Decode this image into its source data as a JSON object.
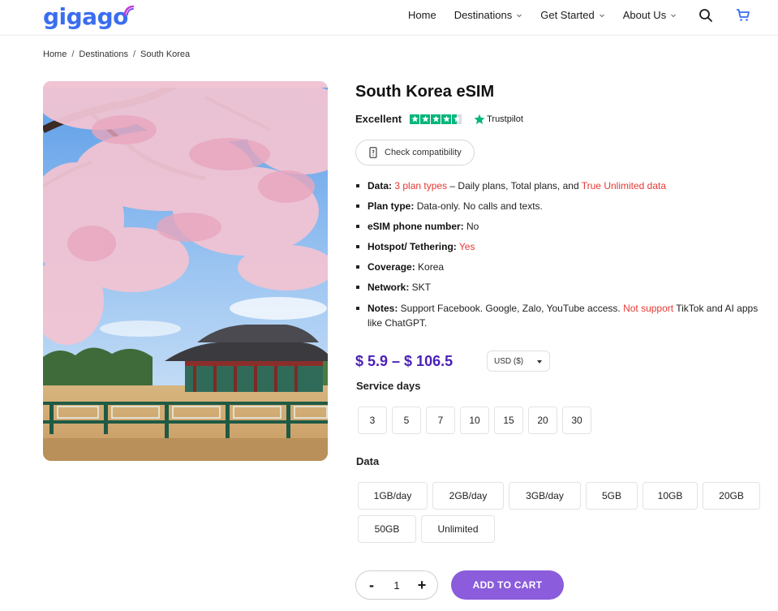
{
  "brand": {
    "logo_text": "gigago",
    "accent": "#3a6df0",
    "purple": "#8b5cdb"
  },
  "nav": {
    "items": [
      {
        "label": "Home",
        "dropdown": false
      },
      {
        "label": "Destinations",
        "dropdown": true
      },
      {
        "label": "Get Started",
        "dropdown": true
      },
      {
        "label": "About Us",
        "dropdown": true
      }
    ],
    "icons": [
      "search-icon",
      "cart-icon"
    ]
  },
  "breadcrumb": [
    "Home",
    "Destinations",
    "South Korea"
  ],
  "product": {
    "title": "South Korea eSIM",
    "rating_text": "Excellent",
    "trustpilot": "Trustpilot",
    "stars": 4.5,
    "compat_label": "Check compatibility",
    "features": {
      "data_label": "Data:",
      "data_plans": "3 plan types",
      "data_middle": " – Daily plans, Total plans, and ",
      "data_unlimited": "True Unlimited data",
      "plan_label": "Plan type:",
      "plan_value": " Data-only. No calls and texts.",
      "phone_label": "eSIM phone number:",
      "phone_value": " No",
      "hotspot_label": "Hotspot/ Tethering:",
      "hotspot_value": " Yes",
      "coverage_label": "Coverage:",
      "coverage_value": " Korea",
      "network_label": "Network:",
      "network_value": " SKT",
      "notes_label": "Notes:",
      "notes_value": " Support Facebook. Google, Zalo, YouTube access. ",
      "notes_not": "Not support",
      "notes_end": " TikTok and AI apps like ChatGPT."
    },
    "price": "$ 5.9 – $ 106.5",
    "currency": "USD ($)",
    "service_days_label": "Service days",
    "service_days": [
      "3",
      "5",
      "7",
      "10",
      "15",
      "20",
      "30"
    ],
    "data_label": "Data",
    "data_options": [
      "1GB/day",
      "2GB/day",
      "3GB/day",
      "5GB",
      "10GB",
      "20GB",
      "50GB",
      "Unlimited"
    ],
    "quantity": "1",
    "minus": "-",
    "plus": "+",
    "add_to_cart": "ADD TO CART"
  }
}
